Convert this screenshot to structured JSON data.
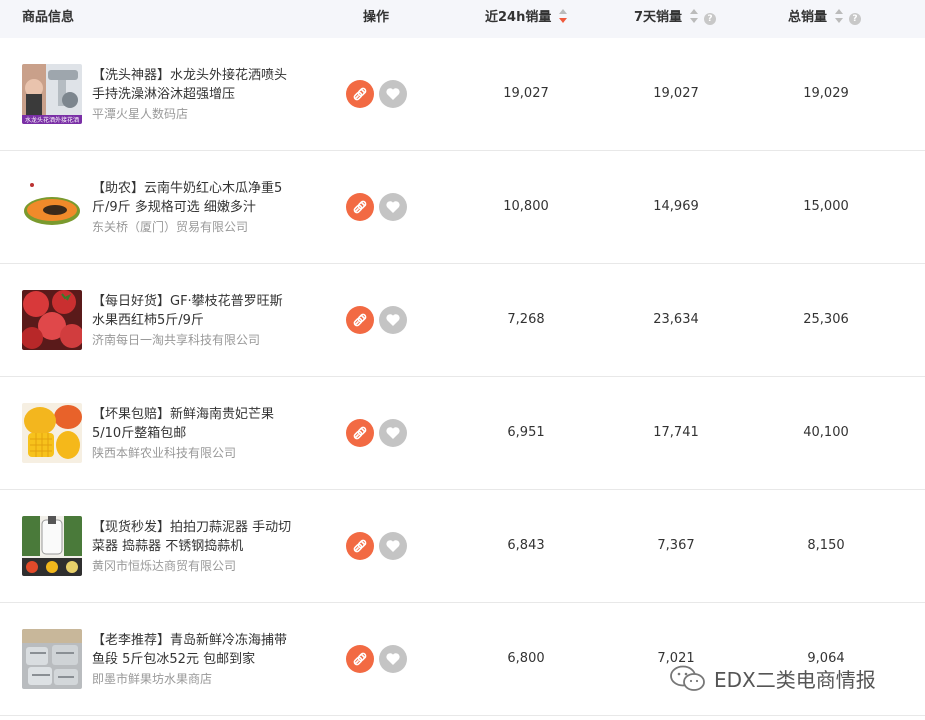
{
  "header": {
    "product": "商品信息",
    "ops": "操作",
    "sales24h": "近24h销量",
    "sales7d": "7天销量",
    "total": "总销量"
  },
  "rows": [
    {
      "title": "【洗头神器】水龙头外接花洒喷头手持洗澡淋浴沐超强增压",
      "shop": "平潭火星人数码店",
      "thumb_text": "水龙头花洒外接花洒",
      "s24": "19,027",
      "s7": "19,027",
      "total": "19,029"
    },
    {
      "title": "【助农】云南牛奶红心木瓜净重5斤/9斤 多规格可选 细嫩多汁",
      "shop": "东关桥（厦门）贸易有限公司",
      "thumb_text": "",
      "s24": "10,800",
      "s7": "14,969",
      "total": "15,000"
    },
    {
      "title": "【每日好货】GF·攀枝花普罗旺斯水果西红柿5斤/9斤",
      "shop": "济南每日一淘共享科技有限公司",
      "thumb_text": "",
      "s24": "7,268",
      "s7": "23,634",
      "total": "25,306"
    },
    {
      "title": "【坏果包赔】新鲜海南贵妃芒果5/10斤整箱包邮",
      "shop": "陕西本鲜农业科技有限公司",
      "thumb_text": "",
      "s24": "6,951",
      "s7": "17,741",
      "total": "40,100"
    },
    {
      "title": "【现货秒发】拍拍刀蒜泥器 手动切菜器 捣蒜器 不锈钢捣蒜机",
      "shop": "黄冈市恒烁达商贸有限公司",
      "thumb_text": "",
      "s24": "6,843",
      "s7": "7,367",
      "total": "8,150"
    },
    {
      "title": "【老李推荐】青岛新鲜冷冻海捕带鱼段 5斤包冰52元 包邮到家",
      "shop": "即墨市鲜果坊水果商店",
      "thumb_text": "",
      "s24": "6,800",
      "s7": "7,021",
      "total": "9,064"
    }
  ],
  "watermark": "EDX二类电商情报",
  "colors": {
    "accent": "#f26a43",
    "header_bg": "#f5f6fa",
    "fav": "#c4c4c4"
  },
  "icons": {
    "link": "link-icon",
    "fav": "heart-icon",
    "help": "question-icon",
    "sort": "sort-icon"
  }
}
